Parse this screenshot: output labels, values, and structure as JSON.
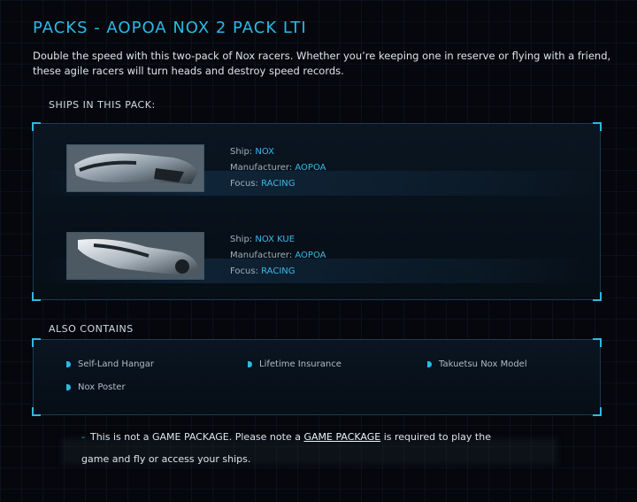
{
  "page": {
    "title": "PACKS - AOPOA NOX 2 PACK LTI",
    "description": "Double the speed with this two-pack of Nox racers. Whether you’re keeping one in reserve or flying with a friend, these agile racers will turn heads and destroy speed records."
  },
  "ships_section": {
    "label": "SHIPS IN THIS PACK:",
    "ships": [
      {
        "ship_label": "Ship:",
        "ship": "NOX",
        "manufacturer_label": "Manufacturer:",
        "manufacturer": "AOPOA",
        "focus_label": "Focus:",
        "focus": "RACING"
      },
      {
        "ship_label": "Ship:",
        "ship": "NOX KUE",
        "manufacturer_label": "Manufacturer:",
        "manufacturer": "AOPOA",
        "focus_label": "Focus:",
        "focus": "RACING"
      }
    ]
  },
  "contains_section": {
    "label": "ALSO CONTAINS",
    "items": [
      "Self-Land Hangar",
      "Lifetime Insurance",
      "Takuetsu Nox Model",
      "Nox Poster"
    ]
  },
  "note": {
    "dash": "-",
    "text_before": "This is not a GAME PACKAGE. Please note a ",
    "link": "GAME PACKAGE",
    "text_after": " is required to play the game and fly or access your ships."
  },
  "colors": {
    "accent": "#2bb9e6",
    "background": "#05070c",
    "panel_border": "#1b3b52"
  }
}
